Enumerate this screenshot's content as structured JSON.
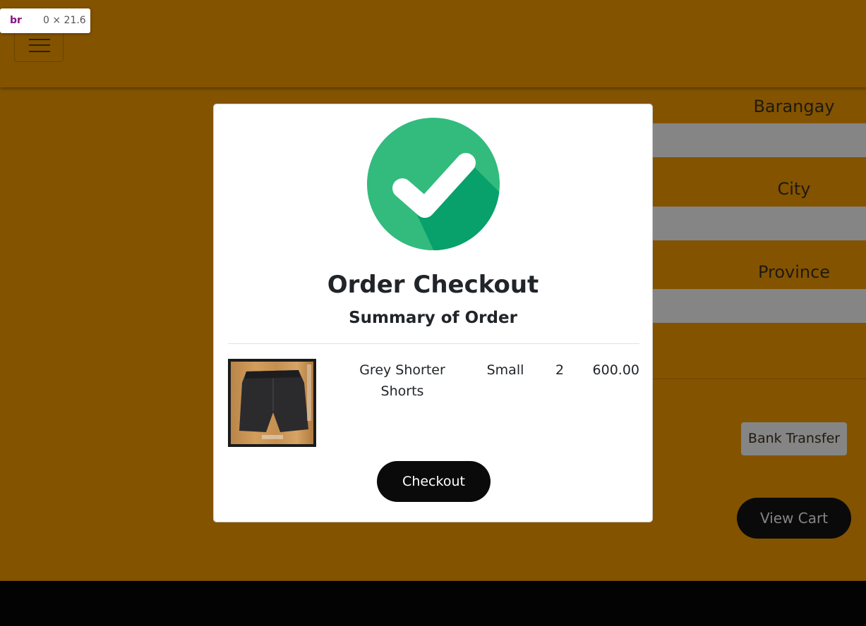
{
  "devtools_tooltip": {
    "tag": "br",
    "dims": "0 × 21.6"
  },
  "navbar": {
    "menu_icon": "hamburger-menu-icon"
  },
  "form": {
    "barangay_label": "Barangay",
    "barangay_value": "",
    "city_label": "City",
    "city_value": "",
    "province_label": "Province",
    "province_value": "",
    "payment_button": "Bank Transfer",
    "view_cart_button": "View Cart"
  },
  "modal": {
    "icon": "check-circle-icon",
    "title": "Order Checkout",
    "subtitle": "Summary of Order",
    "items": [
      {
        "image": "grey-shorts-photo",
        "name": "Grey Shorter Shorts",
        "size": "Small",
        "quantity": "2",
        "price": "600.00"
      }
    ],
    "checkout_button": "Checkout"
  },
  "colors": {
    "page_background": "#835300",
    "input_background": "#858585",
    "button_dark": "#0a0a0a",
    "success_green": "#32bb7d",
    "success_shadow": "#08a06b",
    "footer": "#030303"
  }
}
